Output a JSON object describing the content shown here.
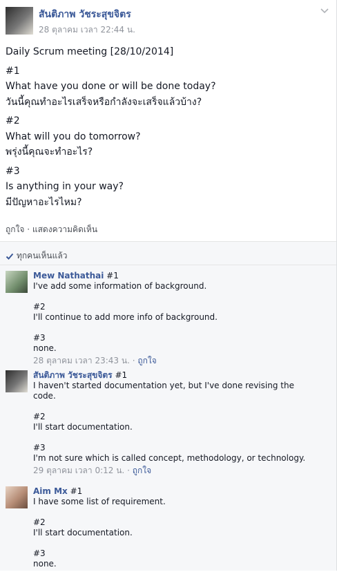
{
  "post": {
    "author": "สันติภาพ วัชระสุขจิตร",
    "time": "28 ตุลาคม เวลา 22:44 น.",
    "title": "Daily Scrum meeting [28/10/2014]",
    "q1_num": "#1",
    "q1_en": "What have you done or will be done today?",
    "q1_th": "วันนี้คุณทำอะไรเสร็จหรือกำลังจะเสร็จแล้วบ้าง?",
    "q2_num": "#2",
    "q2_en": "What will you do tomorrow?",
    "q2_th": "พรุ่งนี้คุณจะทำอะไร?",
    "q3_num": "#3",
    "q3_en": "Is anything in your way?",
    "q3_th": "มีปัญหาอะไรไหม?",
    "like_label": "ถูกใจ",
    "sep": " · ",
    "comment_label": "แสดงความคิดเห็น"
  },
  "seen_by_all": "ทุกคนเห็นแล้ว",
  "comments": [
    {
      "name": "Mew Nathathai",
      "l1": " #1",
      "l2": "I've add some information of background.",
      "l3": "#2",
      "l4": "I'll continue to add more info of background.",
      "l5": "#3",
      "l6": "none.",
      "time": "28 ตุลาคม เวลา 23:43 น.",
      "sep": " · ",
      "like": "ถูกใจ"
    },
    {
      "name": "สันติภาพ วัชระสุขจิตร",
      "l1": " #1",
      "l2a": "I haven't started documentation yet, but I've done revising the",
      "l2b": "code.",
      "l3": "#2",
      "l4": "I'll start documentation.",
      "l5": "#3",
      "l6": "I'm not sure which is called concept, methodology, or technology.",
      "time": "29 ตุลาคม เวลา 0:12 น.",
      "sep": " · ",
      "like": "ถูกใจ"
    },
    {
      "name": "Aim Mx",
      "l1": " #1",
      "l2": "I have some list of requirement.",
      "l3": "#2",
      "l4": "I'll start documentation.",
      "l5": "#3",
      "l6": "none."
    }
  ],
  "icons": {
    "chevron": "chevron-down-icon",
    "check": "check-icon"
  },
  "colors": {
    "link": "#3b5998",
    "meta": "#90949c",
    "ufi_bg": "#f6f7f9"
  }
}
